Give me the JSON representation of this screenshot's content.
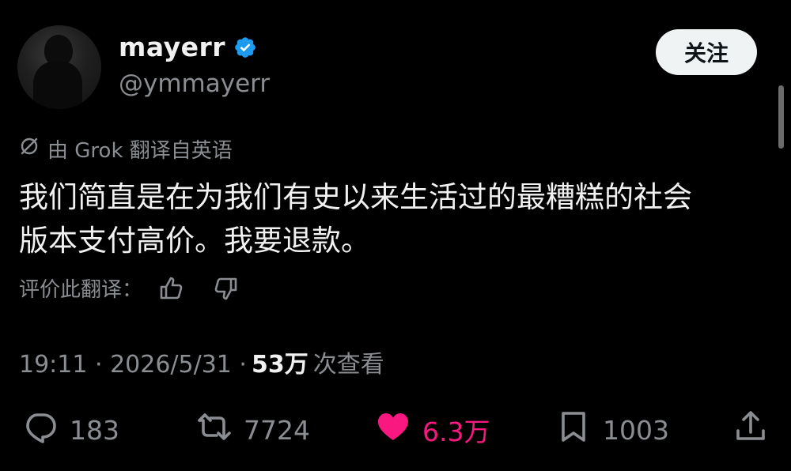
{
  "user": {
    "display_name": "mayerr",
    "handle": "@ymmayerr",
    "verified": true
  },
  "follow_label": "关注",
  "translation_notice": "由 Grok 翻译自英语",
  "tweet": {
    "text_line1": "我们简直是在为我们有史以来生活过的最糟糕的社会",
    "text_line2": "版本支付高价。我要退款。"
  },
  "rate_translation_label": "评价此翻译：",
  "meta": {
    "time": "19:11 · 2026/5/31 ·",
    "views_count": "53万",
    "views_label": "次查看"
  },
  "actions": {
    "replies": "183",
    "reposts": "7724",
    "likes": "6.3万",
    "bookmarks": "1003"
  },
  "icons": {
    "verified": "verified-badge-icon",
    "translate": "translate-icon",
    "thumbs_up": "thumbs-up-icon",
    "thumbs_down": "thumbs-down-icon",
    "reply": "reply-icon",
    "repost": "repost-icon",
    "like": "heart-icon",
    "bookmark": "bookmark-icon",
    "share": "share-icon"
  },
  "colors": {
    "background": "#000000",
    "verified_blue": "#1d9bf0",
    "like_pink": "#f91880",
    "muted": "#8a8d91"
  }
}
